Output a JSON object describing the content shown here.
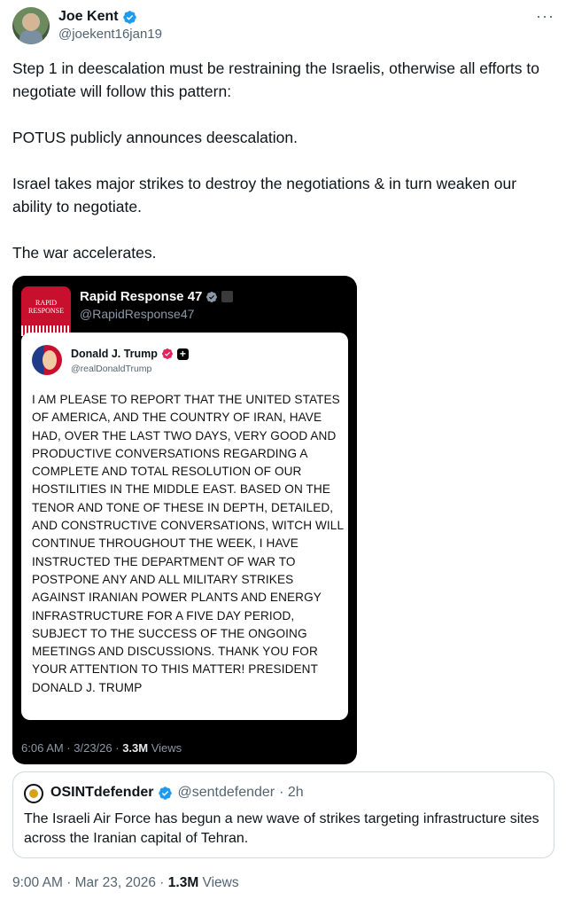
{
  "tweet": {
    "author_name": "Joe Kent",
    "author_handle": "@joekent16jan19",
    "more_label": "···",
    "paragraphs": [
      "Step 1 in deescalation must be restraining the Israelis, otherwise all efforts to negotiate will follow this pattern:",
      "POTUS publicly announces deescalation.",
      "Israel takes major strikes to destroy the negotiations & in turn weaken our ability to negotiate.",
      "The war accelerates."
    ],
    "timestamp": "9:00 AM · Mar 23, 2026 · ",
    "views_count": "1.3M",
    "views_label": " Views"
  },
  "media": {
    "logo_text_line1": "RAPID",
    "logo_text_line2": "RESPONSE",
    "account_name": "Rapid Response 47",
    "account_handle": "@RapidResponse47",
    "inner_post": {
      "name": "Donald J. Trump",
      "handle": "@realDonaldTrump",
      "plus": "+",
      "text": "I AM PLEASE TO REPORT THAT THE UNITED STATES OF AMERICA, AND THE COUNTRY OF IRAN, HAVE HAD, OVER THE LAST TWO DAYS, VERY GOOD AND PRODUCTIVE CONVERSATIONS REGARDING A COMPLETE AND TOTAL RESOLUTION OF OUR HOSTILITIES IN THE MIDDLE EAST. BASED ON THE TENOR AND TONE OF THESE IN DEPTH, DETAILED, AND CONSTRUCTIVE CONVERSATIONS, WITCH WILL CONTINUE THROUGHOUT THE WEEK, I HAVE INSTRUCTED THE DEPARTMENT OF WAR TO POSTPONE ANY AND ALL MILITARY STRIKES AGAINST IRANIAN POWER PLANTS AND ENERGY INFRASTRUCTURE FOR A FIVE DAY PERIOD, SUBJECT TO THE SUCCESS OF THE ONGOING MEETINGS AND DISCUSSIONS. THANK YOU FOR YOUR ATTENTION TO THIS MATTER! PRESIDENT DONALD J. TRUMP"
    },
    "meta_time": "6:06 AM · 3/23/26 · ",
    "meta_views_count": "3.3M",
    "meta_views_label": " Views"
  },
  "quote": {
    "name": "OSINTdefender",
    "handle": "@sentdefender",
    "age": "· 2h",
    "text": "The Israeli Air Force has begun a new wave of strikes targeting infrastructure sites across the Iranian capital of Tehran."
  },
  "colors": {
    "verified_blue": "#1d9bf0",
    "trump_badge": "#e0245e",
    "secondary_text": "#536471"
  }
}
